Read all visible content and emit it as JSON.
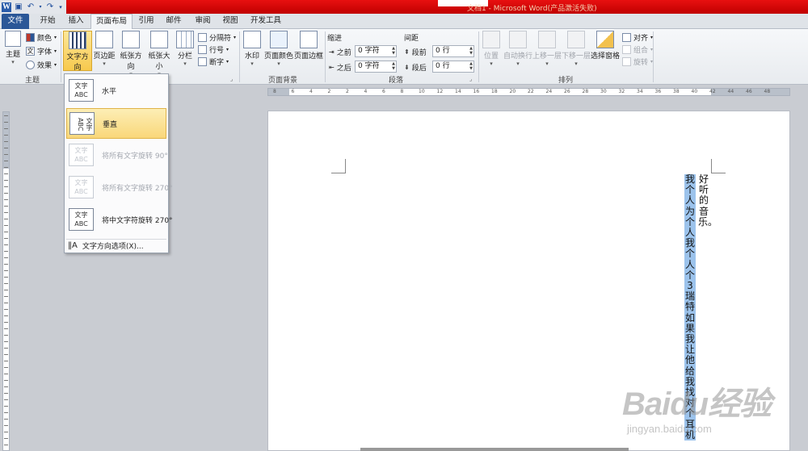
{
  "titlebar": {
    "title": "文档1 - Microsoft Word(产品激活失败)",
    "logo": "W"
  },
  "tabs": [
    "文件",
    "开始",
    "插入",
    "页面布局",
    "引用",
    "邮件",
    "审阅",
    "视图",
    "开发工具"
  ],
  "ribbon": {
    "themes": {
      "theme": "主题",
      "colors": "颜色",
      "fonts": "字体",
      "effects": "效果",
      "group": "主题"
    },
    "page_setup": {
      "text_direction": "文字方向",
      "margins": "页边距",
      "orientation": "纸张方向",
      "size": "纸张大小",
      "columns": "分栏",
      "breaks": "分隔符",
      "line_numbers": "行号",
      "hyphenation": "断字"
    },
    "page_background": {
      "watermark": "水印",
      "page_color": "页面颜色",
      "page_borders": "页面边框",
      "group": "页面背景"
    },
    "paragraph": {
      "indent": "缩进",
      "spacing": "间距",
      "before_indent_label": "之前",
      "before_indent_value": "0 字符",
      "after_indent_label": "之后",
      "after_indent_value": "0 字符",
      "space_before_label": "段前",
      "space_before_value": "0 行",
      "space_after_label": "段后",
      "space_after_value": "0 行",
      "group": "段落"
    },
    "arrange": {
      "position": "位置",
      "wrap": "自动换行",
      "forward": "上移一层",
      "backward": "下移一层",
      "selection_pane": "选择窗格",
      "align": "对齐",
      "group_btn": "组合",
      "rotate": "旋转",
      "group": "排列"
    }
  },
  "dropdown": {
    "items": [
      {
        "icon_text": "文字 ABC",
        "label": "水平"
      },
      {
        "icon_text": "文字 ABC",
        "label": "垂直"
      },
      {
        "icon_text": "文字 ABC",
        "label": "将所有文字旋转 90°"
      },
      {
        "icon_text": "文字 ABC",
        "label": "将所有文字旋转 270°"
      },
      {
        "icon_text": "文字 ABC",
        "label": "将中文字符旋转 270°"
      }
    ],
    "options": "文字方向选项(X)..."
  },
  "ruler": {
    "ticks": [
      "8",
      "6",
      "4",
      "2",
      "2",
      "4",
      "6",
      "8",
      "10",
      "12",
      "14",
      "16",
      "18",
      "20",
      "22",
      "24",
      "26",
      "28",
      "30",
      "32",
      "34",
      "36",
      "38",
      "40",
      "42",
      "44",
      "46",
      "48"
    ]
  },
  "document": {
    "col1": "好听的音乐。",
    "col2": "我个人为个人我个人个3瑞特如果我让他给我找对个耳机"
  },
  "watermark": {
    "line1": "Baidu经验",
    "line2": "jingyan.baidu.com"
  }
}
